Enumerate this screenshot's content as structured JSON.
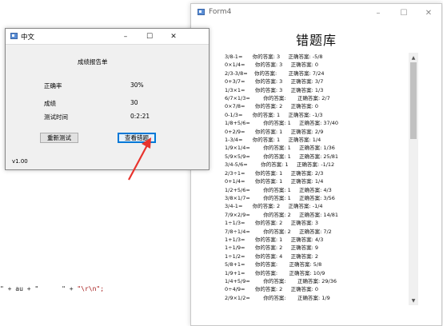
{
  "code_snippet": {
    "part1": "\" + au + \"      \" + ",
    "part2": "\"\\r\\n\";"
  },
  "form4": {
    "title": "Form4",
    "heading": "错题库",
    "controls": {
      "minimize": "–",
      "maximize": "☐",
      "close": "✕"
    },
    "lines": [
      "3/8-1=      你的答案: 3     正确答案: -5/8",
      "0×1/4=      你的答案: 3     正确答案: 0",
      "2/3-3/8=    你的答案:       正确答案: 7/24",
      "0+3/7=      你的答案: 3     正确答案: 3/7",
      "1/3×1=      你的答案: 3     正确答案: 1/3",
      "6/7×1/3=        你的答案:       正确答案: 2/7",
      "0×7/8=      你的答案: 2     正确答案: 0",
      "0-1/3=      你的答案: 1     正确答案: -1/3",
      "1/8+5/6=        你的答案: 1     正确答案: 37/40",
      "0+2/9=      你的答案: 1     正确答案: 2/9",
      "1-3/4=      你的答案: 1     正确答案: 1/4",
      "1/9×1/4=        你的答案: 1     正确答案: 1/36",
      "5/9×5/9=        你的答案: 1     正确答案: 25/81",
      "3/4-5/6=        你的答案: 1     正确答案: -1/12",
      "2/3÷1=      你的答案: 1     正确答案: 2/3",
      "0+1/4=      你的答案: 1     正确答案: 1/4",
      "1/2+5/6=        你的答案: 1     正确答案: 4/3",
      "3/8×1/7=        你的答案: 1     正确答案: 3/56",
      "3/4-1=      你的答案: 2     正确答案: -1/4",
      "7/9×2/9=        你的答案: 2     正确答案: 14/81",
      "1÷1/3=      你的答案: 2     正确答案: 3",
      "7/8÷1/4=        你的答案: 2     正确答案: 7/2",
      "1+1/3=      你的答案: 1     正确答案: 4/3",
      "1÷1/9=      你的答案: 2     正确答案: 9",
      "1÷1/2=      你的答案: 4     正确答案: 2",
      "5/8+1=      你的答案:       正确答案: 5/8",
      "1/9+1=      你的答案:       正确答案: 10/9",
      "1/4+5/9=        你的答案:       正确答案: 29/36",
      "0÷4/9=      你的答案: 2     正确答案: 0",
      "2/9×1/2=        你的答案:       正确答案: 1/9"
    ],
    "scrollbar": {
      "up_arrow": "▲",
      "down_arrow": "▼"
    }
  },
  "report_window": {
    "title": "中文",
    "controls": {
      "minimize": "–",
      "maximize": "☐",
      "close": "✕"
    },
    "report_title": "成绩报告单",
    "accuracy_label": "正确率",
    "accuracy_value": "30%",
    "score_label": "成绩",
    "score_value": "30",
    "time_label": "测试时间",
    "time_value": "0:2:21",
    "retest_button": "重新测试",
    "view_mistakes_button": "查看错题",
    "version": "v1.00"
  },
  "colors": {
    "arrow": "#e8332d",
    "focus_border": "#0078d7"
  }
}
